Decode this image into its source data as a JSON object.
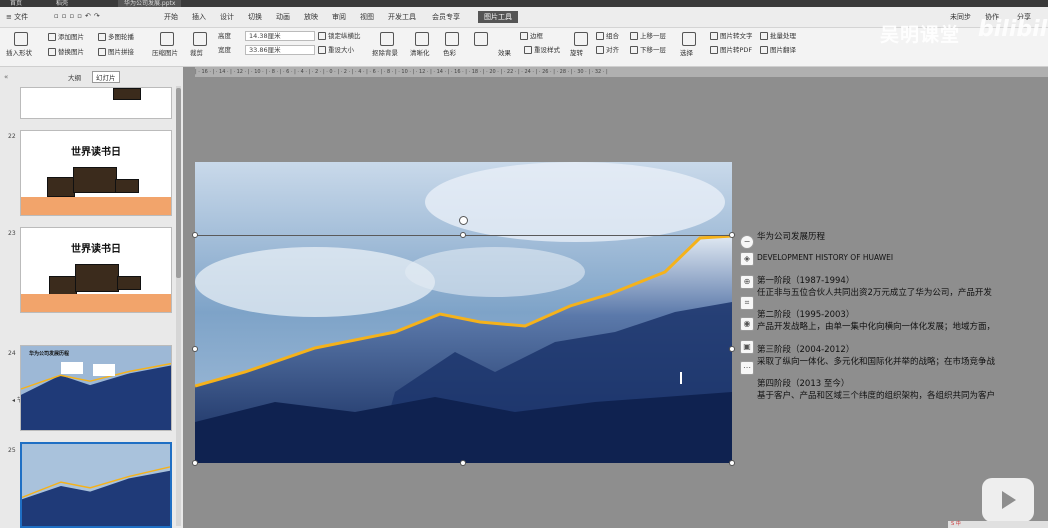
{
  "titlebar": {
    "tabs": [
      "首页",
      "稻壳",
      "华为公司发展.pptx"
    ]
  },
  "menu": [
    "开始",
    "插入",
    "设计",
    "切换",
    "动画",
    "放映",
    "审阅",
    "视图",
    "开发工具",
    "会员专享",
    "图片工具"
  ],
  "menu_right": [
    "未同步",
    "协作",
    "分享"
  ],
  "file_label": "文件",
  "ribbon": {
    "insert_shape": "插入形状",
    "add_image": "添加图片",
    "multi_image": "多图轮播",
    "replace_image": "替换图片",
    "image_stitch": "图片拼接",
    "compress": "压缩图片",
    "crop": "裁剪",
    "height_label": "高度",
    "height_value": "14.38厘米",
    "width_label": "宽度",
    "width_value": "33.86厘米",
    "lock_ratio": "锁定纵横比",
    "reset_size": "重设大小",
    "remove_bg": "抠除背景",
    "sharpen": "清晰化",
    "color": "色彩",
    "border": "边框",
    "effect": "效果",
    "reset_style": "重设样式",
    "rotate": "旋转",
    "group": "组合",
    "align": "对齐",
    "up_layer": "上移一层",
    "down_layer": "下移一层",
    "select": "选择",
    "img_to_text": "图片转文字",
    "batch": "批量处理",
    "img_to_pdf": "图片转PDF",
    "translate": "图片翻译"
  },
  "watermark": {
    "text": "吴明课堂",
    "brand": "bilibili"
  },
  "panel": {
    "tab_outline": "大纲",
    "tab_slides": "幻灯片",
    "section": "节1"
  },
  "slides": [
    {
      "num": "22",
      "title": "世界读书日"
    },
    {
      "num": "23",
      "title": "世界读书日"
    },
    {
      "num": "24",
      "title": "华为公司发展历程"
    },
    {
      "num": "25",
      "title": ""
    }
  ],
  "text_blocks": {
    "title": "华为公司发展历程",
    "subtitle": "DEVELOPMENT HISTORY OF HUAWEI",
    "stage1": "第一阶段（1987-1994）",
    "stage1_desc": "任正非与五位合伙人共同出资2万元成立了华为公司，产品开发",
    "stage2": "第二阶段（1995-2003）",
    "stage2_desc": "产品开发战略上，由单一集中化向横向一体化发展；地域方面，",
    "stage3": "第三阶段（2004-2012）",
    "stage3_desc": "采取了纵向一体化、多元化和国际化并举的战略；在市场竞争战",
    "stage4": "第四阶段（2013 至今）",
    "stage4_desc": "基于客户、产品和区域三个纬度的组织架构，各组织共同为客户"
  },
  "colors": {
    "accent": "#f5b21b",
    "sky": "#7fa4c9",
    "mountain": "#1f3a78",
    "thumb_accent": "#f2a46b"
  },
  "status": {
    "text": "S 中"
  }
}
